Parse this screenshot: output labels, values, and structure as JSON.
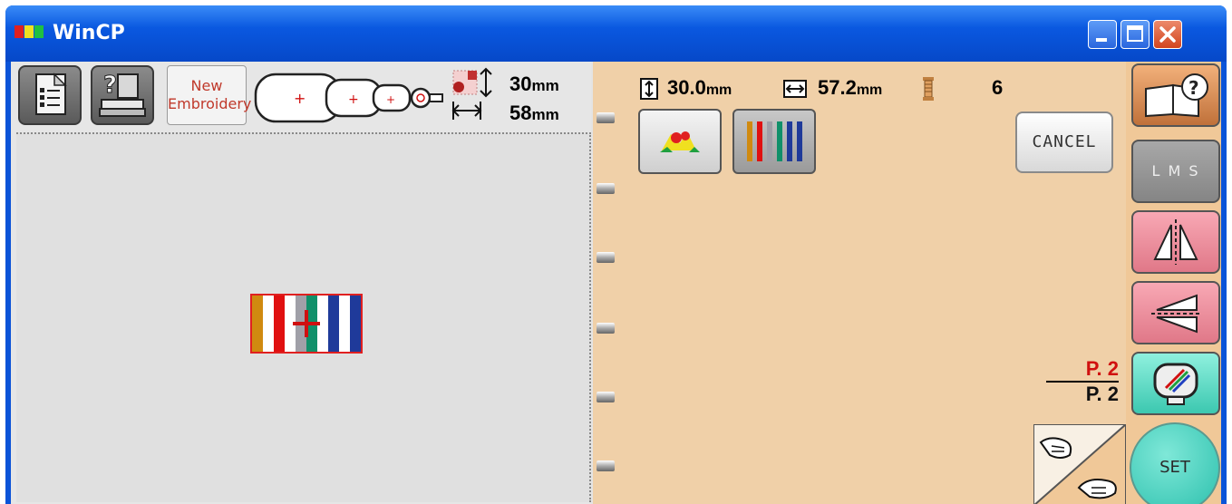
{
  "window": {
    "title": "WinCP",
    "buttons": [
      "minimize",
      "maximize",
      "close"
    ]
  },
  "left_toolbar": {
    "new_embroidery_line1": "New",
    "new_embroidery_line2": "Embroidery",
    "height_value": "30",
    "width_value": "58",
    "unit": "mm"
  },
  "info_bar": {
    "height_value": "30.0",
    "width_value": "57.2",
    "unit": "mm",
    "thread_count": "6"
  },
  "buttons": {
    "cancel": "CANCEL",
    "lms": "L M S",
    "set": "SET"
  },
  "page_indicator": {
    "current": "P. 2",
    "total": "P. 2"
  },
  "colors": {
    "title_bar": "#0a58e0",
    "page_bg": "#f0d0a8",
    "canvas_bg": "#e0e0e0",
    "mirror_btn": "#f08a9a",
    "preview_btn": "#3cc8b0",
    "set_btn": "#2cc0ad"
  },
  "design_stripes": [
    "#d08a10",
    "#ffffff",
    "#e01010",
    "#ffffff",
    "#a0a0a8",
    "#10906a",
    "#ffffff",
    "#1f3a9a",
    "#ffffff",
    "#1f3a9a"
  ],
  "thread_colors": [
    "#d08a10",
    "#e01010",
    "#a0a0a8",
    "#10906a",
    "#1f3a9a",
    "#1f3a9a"
  ]
}
